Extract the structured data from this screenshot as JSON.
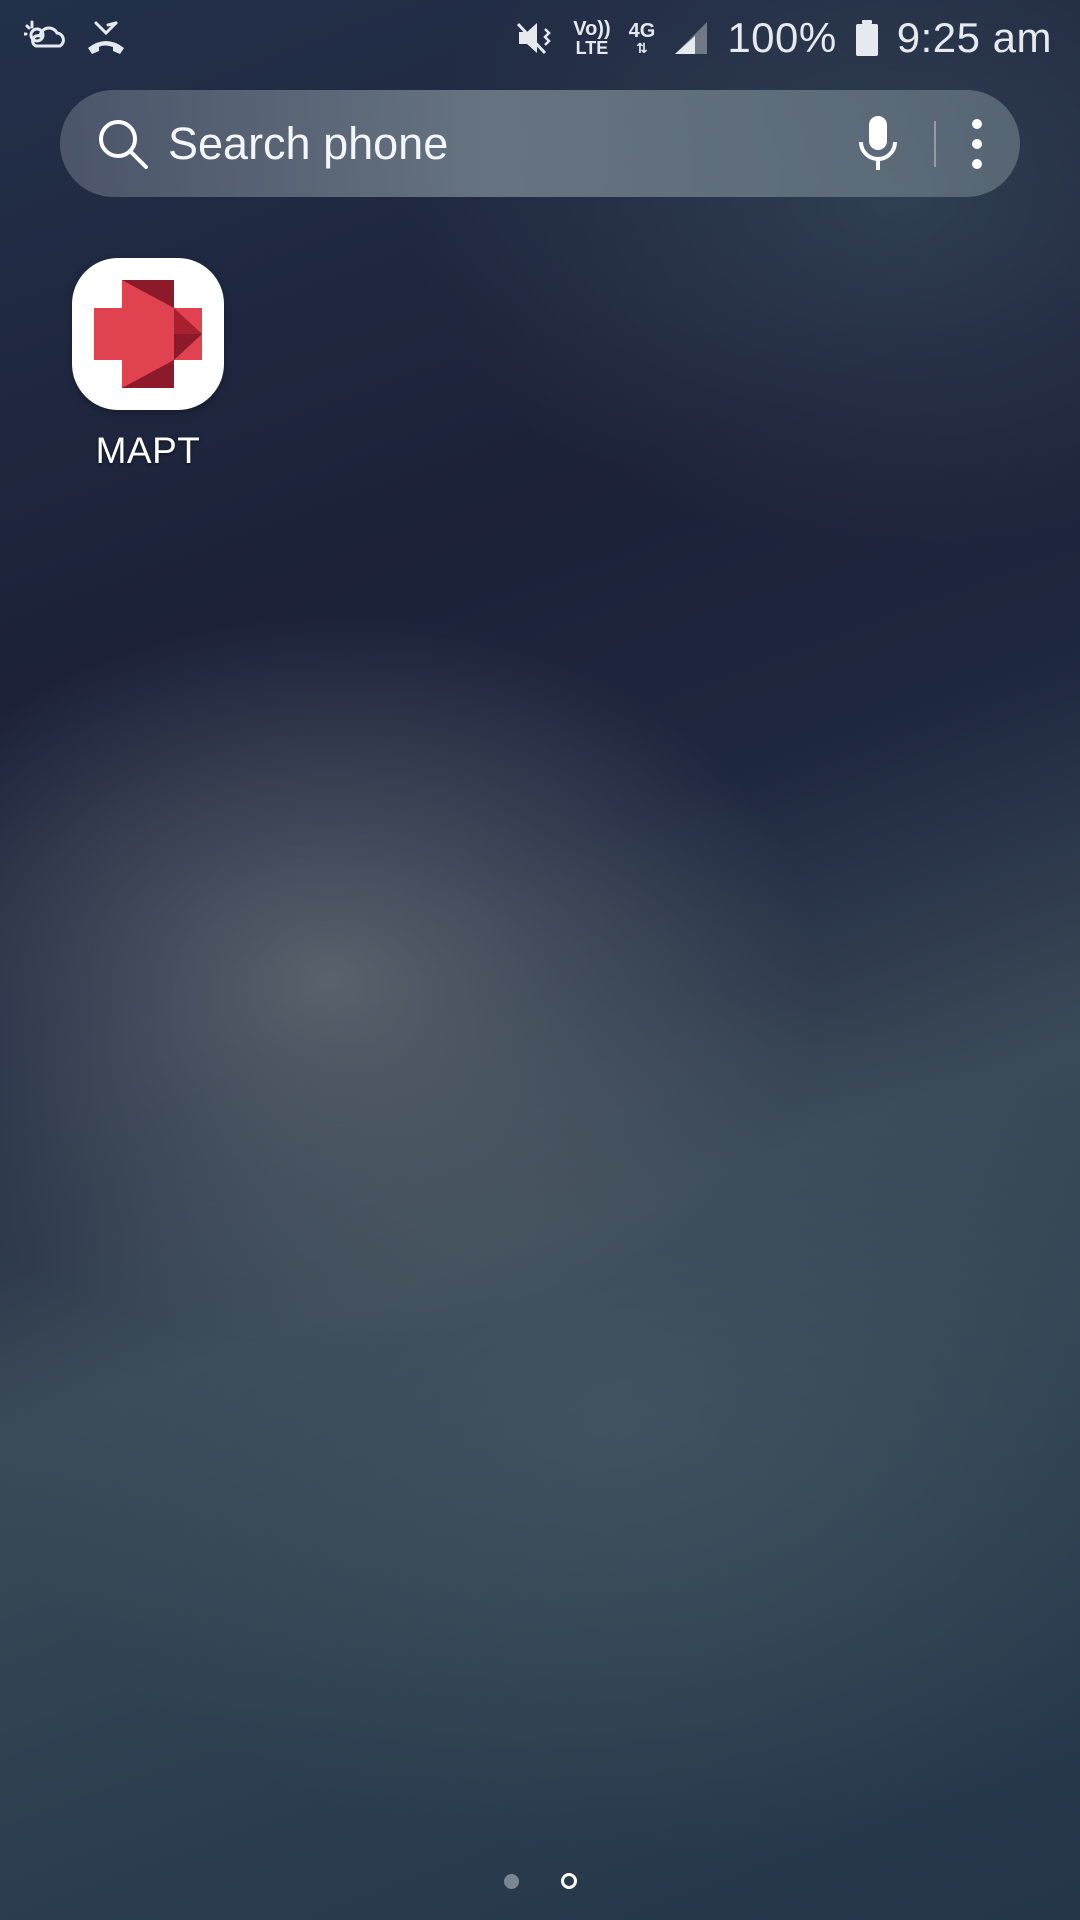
{
  "status_bar": {
    "left_icons": [
      "weather-icon",
      "missed-call-icon"
    ],
    "right_icons": [
      "mute-icon",
      "volte-icon",
      "network-4g-icon",
      "signal-icon",
      "battery-icon"
    ],
    "volte_top": "Vo))",
    "volte_bottom": "LTE",
    "network_type": "4G",
    "battery": "100%",
    "time": "9:25 am"
  },
  "search": {
    "placeholder": "Search phone",
    "icons": [
      "search-icon",
      "mic-icon",
      "more-options-icon"
    ]
  },
  "apps": [
    {
      "label": "MAPT",
      "icon": "red-cross-arrow-icon"
    }
  ],
  "page_indicator": {
    "count": 2,
    "current": 2
  },
  "colors": {
    "cross_red": "#e0424f",
    "cross_dark": "#8c1a2a"
  }
}
